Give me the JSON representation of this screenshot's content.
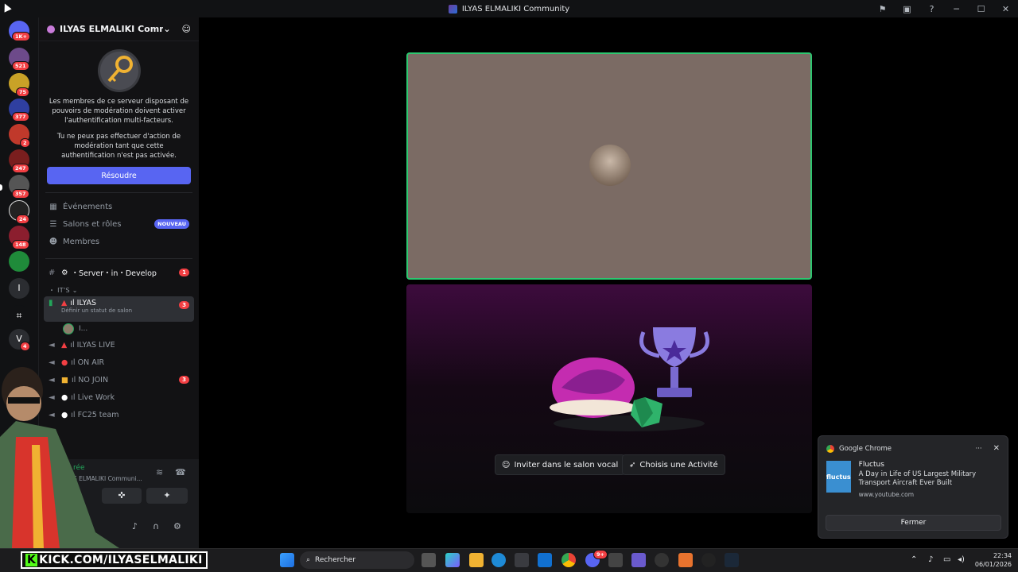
{
  "window": {
    "title": "ILYAS ELMALIKI Community",
    "controls": [
      "─",
      "☐",
      "✕"
    ]
  },
  "server_list": {
    "badges": [
      "1K+",
      "521",
      "75",
      "377",
      "2",
      "247",
      "357",
      "24",
      "148",
      "4"
    ],
    "letters": [
      "I",
      "V"
    ]
  },
  "server_header": {
    "name": "ILYAS ELMALIKI Comm…",
    "chevron": "⌄"
  },
  "mfa_notice": {
    "text1": "Les membres de ce serveur disposant de pouvoirs de modération doivent activer l'authentification multi-facteurs.",
    "text2": "Tu ne peux pas effectuer d'action de modération tant que cette authentification n'est pas activée.",
    "button": "Résoudre"
  },
  "nav": {
    "events": "Événements",
    "channels_roles": "Salons et rôles",
    "new_badge": "NOUVEAU",
    "members": "Membres"
  },
  "channels": {
    "server_in_develop": "・Server・in・Develop",
    "server_in_develop_count": "1",
    "category": "・ IT'S ⌄",
    "active_voice": "ıl ILYAS",
    "active_voice_count": "3",
    "active_voice_status": "Définir un statut de salon",
    "voice_user": "I...",
    "ilyas_live": "ıl ILYAS LIVE",
    "on_air": "ıl ON AIR",
    "no_join": "ıl NO JOIN",
    "no_join_count": "3",
    "live_work": "ıl Live Work",
    "fc25": "ıl FC25 team"
  },
  "user_panel": {
    "status": "rée",
    "server": "S ELMALIKI Communi..."
  },
  "activity": {
    "invite_button": "Inviter dans le salon vocal",
    "choose_button": "Choisis une Activité"
  },
  "notification": {
    "app": "Google Chrome",
    "thumb_text": "fluctus",
    "title": "Fluctus",
    "body": "A Day in Life of US Largest Military Transport Aircraft Ever Built",
    "source": "www.youtube.com",
    "close_button": "Fermer",
    "more": "···",
    "dismiss": "✕"
  },
  "taskbar": {
    "kick_url": "KICK.COM/ILYASELMALIKI",
    "kick_k": "K",
    "search_placeholder": "Rechercher",
    "time": "22:34",
    "date": "06/01/2026",
    "discord_badge": "9+"
  },
  "colors": {
    "accent": "#5865f2",
    "speaking_border": "#2dc770",
    "danger": "#f23f43",
    "kick_green": "#53fc18"
  }
}
